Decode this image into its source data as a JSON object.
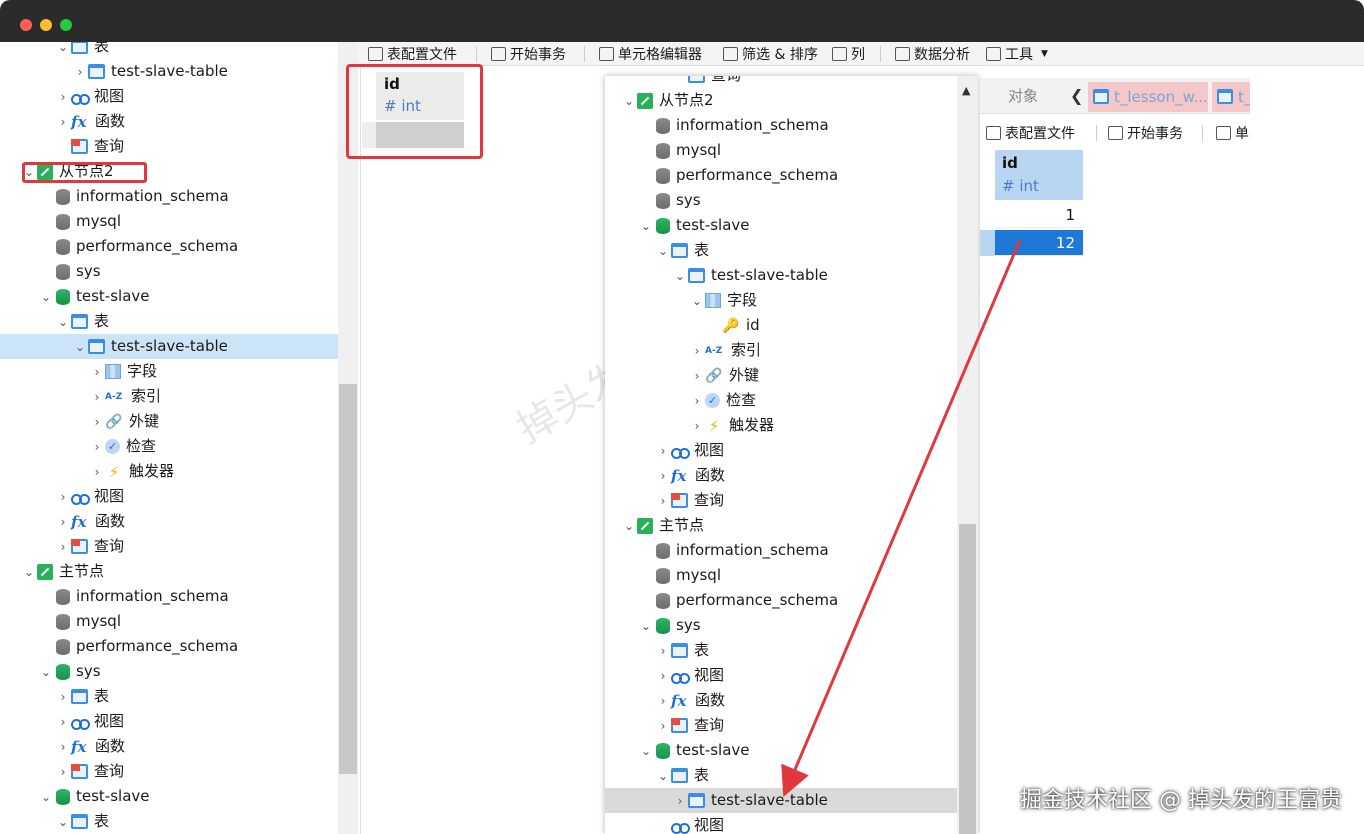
{
  "left_tree": [
    {
      "indent": 1,
      "chevron": "down",
      "icon": "table",
      "label": "表"
    },
    {
      "indent": 2,
      "chevron": "right",
      "icon": "table",
      "label": "test-slave-table"
    },
    {
      "indent": 1,
      "chevron": "right",
      "icon": "view",
      "label": "视图"
    },
    {
      "indent": 1,
      "chevron": "right",
      "icon": "func",
      "label": "函数"
    },
    {
      "indent": 1,
      "chevron": "none",
      "icon": "query",
      "label": "查询"
    },
    {
      "indent": -1,
      "chevron": "down",
      "icon": "conn",
      "label": "从节点2"
    },
    {
      "indent": 0,
      "chevron": "none",
      "icon": "db-gray",
      "label": "information_schema"
    },
    {
      "indent": 0,
      "chevron": "none",
      "icon": "db-gray",
      "label": "mysql"
    },
    {
      "indent": 0,
      "chevron": "none",
      "icon": "db-gray",
      "label": "performance_schema"
    },
    {
      "indent": 0,
      "chevron": "none",
      "icon": "db-gray",
      "label": "sys"
    },
    {
      "indent": 0,
      "chevron": "down",
      "icon": "db-green",
      "label": "test-slave"
    },
    {
      "indent": 1,
      "chevron": "down",
      "icon": "table",
      "label": "表"
    },
    {
      "indent": 2,
      "chevron": "down",
      "icon": "table",
      "label": "test-slave-table",
      "selected": true
    },
    {
      "indent": 3,
      "chevron": "right",
      "icon": "field",
      "label": "字段"
    },
    {
      "indent": 3,
      "chevron": "right",
      "icon": "index",
      "label": "索引"
    },
    {
      "indent": 3,
      "chevron": "right",
      "icon": "fk",
      "label": "外键"
    },
    {
      "indent": 3,
      "chevron": "right",
      "icon": "check",
      "label": "检查"
    },
    {
      "indent": 3,
      "chevron": "right",
      "icon": "trigger",
      "label": "触发器"
    },
    {
      "indent": 1,
      "chevron": "right",
      "icon": "view",
      "label": "视图"
    },
    {
      "indent": 1,
      "chevron": "right",
      "icon": "func",
      "label": "函数"
    },
    {
      "indent": 1,
      "chevron": "right",
      "icon": "query",
      "label": "查询"
    },
    {
      "indent": -1,
      "chevron": "down",
      "icon": "conn",
      "label": "主节点"
    },
    {
      "indent": 0,
      "chevron": "none",
      "icon": "db-gray",
      "label": "information_schema"
    },
    {
      "indent": 0,
      "chevron": "none",
      "icon": "db-gray",
      "label": "mysql"
    },
    {
      "indent": 0,
      "chevron": "none",
      "icon": "db-gray",
      "label": "performance_schema"
    },
    {
      "indent": 0,
      "chevron": "down",
      "icon": "db-green",
      "label": "sys"
    },
    {
      "indent": 1,
      "chevron": "right",
      "icon": "table",
      "label": "表"
    },
    {
      "indent": 1,
      "chevron": "right",
      "icon": "view",
      "label": "视图"
    },
    {
      "indent": 1,
      "chevron": "right",
      "icon": "func",
      "label": "函数"
    },
    {
      "indent": 1,
      "chevron": "right",
      "icon": "query",
      "label": "查询"
    },
    {
      "indent": 0,
      "chevron": "down",
      "icon": "db-green",
      "label": "test-slave"
    },
    {
      "indent": 1,
      "chevron": "down",
      "icon": "table",
      "label": "表"
    }
  ],
  "overlay_tree": [
    {
      "indent": 3,
      "chevron": "none",
      "icon": "query",
      "label": "查询"
    },
    {
      "indent": 0,
      "chevron": "down",
      "icon": "conn",
      "label": "从节点2"
    },
    {
      "indent": 1,
      "chevron": "none",
      "icon": "db-gray",
      "label": "information_schema"
    },
    {
      "indent": 1,
      "chevron": "none",
      "icon": "db-gray",
      "label": "mysql"
    },
    {
      "indent": 1,
      "chevron": "none",
      "icon": "db-gray",
      "label": "performance_schema"
    },
    {
      "indent": 1,
      "chevron": "none",
      "icon": "db-gray",
      "label": "sys"
    },
    {
      "indent": 1,
      "chevron": "down",
      "icon": "db-green",
      "label": "test-slave"
    },
    {
      "indent": 2,
      "chevron": "down",
      "icon": "table",
      "label": "表"
    },
    {
      "indent": 3,
      "chevron": "down",
      "icon": "table",
      "label": "test-slave-table"
    },
    {
      "indent": 4,
      "chevron": "down",
      "icon": "field",
      "label": "字段"
    },
    {
      "indent": 5,
      "chevron": "none",
      "icon": "key",
      "label": "id"
    },
    {
      "indent": 4,
      "chevron": "right",
      "icon": "index",
      "label": "索引"
    },
    {
      "indent": 4,
      "chevron": "right",
      "icon": "fk",
      "label": "外键"
    },
    {
      "indent": 4,
      "chevron": "right",
      "icon": "check",
      "label": "检查"
    },
    {
      "indent": 4,
      "chevron": "right",
      "icon": "trigger",
      "label": "触发器"
    },
    {
      "indent": 2,
      "chevron": "right",
      "icon": "view",
      "label": "视图"
    },
    {
      "indent": 2,
      "chevron": "right",
      "icon": "func",
      "label": "函数"
    },
    {
      "indent": 2,
      "chevron": "right",
      "icon": "query",
      "label": "查询"
    },
    {
      "indent": 0,
      "chevron": "down",
      "icon": "conn",
      "label": "主节点"
    },
    {
      "indent": 1,
      "chevron": "none",
      "icon": "db-gray",
      "label": "information_schema"
    },
    {
      "indent": 1,
      "chevron": "none",
      "icon": "db-gray",
      "label": "mysql"
    },
    {
      "indent": 1,
      "chevron": "none",
      "icon": "db-gray",
      "label": "performance_schema"
    },
    {
      "indent": 1,
      "chevron": "down",
      "icon": "db-green",
      "label": "sys"
    },
    {
      "indent": 2,
      "chevron": "right",
      "icon": "table",
      "label": "表"
    },
    {
      "indent": 2,
      "chevron": "right",
      "icon": "view",
      "label": "视图"
    },
    {
      "indent": 2,
      "chevron": "right",
      "icon": "func",
      "label": "函数"
    },
    {
      "indent": 2,
      "chevron": "right",
      "icon": "query",
      "label": "查询"
    },
    {
      "indent": 1,
      "chevron": "down",
      "icon": "db-green",
      "label": "test-slave"
    },
    {
      "indent": 2,
      "chevron": "down",
      "icon": "table",
      "label": "表"
    },
    {
      "indent": 3,
      "chevron": "right",
      "icon": "table",
      "label": "test-slave-table",
      "selected": true
    },
    {
      "indent": 2,
      "chevron": "none",
      "icon": "view",
      "label": "视图"
    }
  ],
  "main_toolbar": {
    "table_profile": "表配置文件",
    "begin_tx": "开始事务",
    "cell_editor": "单元格编辑器",
    "filter_sort": "筛选 & 排序",
    "columns": "列",
    "data_analysis": "数据分析",
    "tools": "工具"
  },
  "main_grid": {
    "col_name": "id",
    "col_type": "# int"
  },
  "right_panel": {
    "tab_objects": "对象",
    "tab1": "t_lesson_w...",
    "tab2": "t_",
    "toolbar_profile": "表配置文件",
    "toolbar_begin": "开始事务",
    "toolbar_cell": "单",
    "col_name": "id",
    "col_type": "# int",
    "rows": [
      "1",
      "12"
    ]
  },
  "watermark": "掉头发的王富贵",
  "footer_watermark": "掘金技术社区 @ 掉头发的王富贵",
  "colors": {
    "accent": "#1e78d7",
    "annotation_red": "#e0383c"
  }
}
